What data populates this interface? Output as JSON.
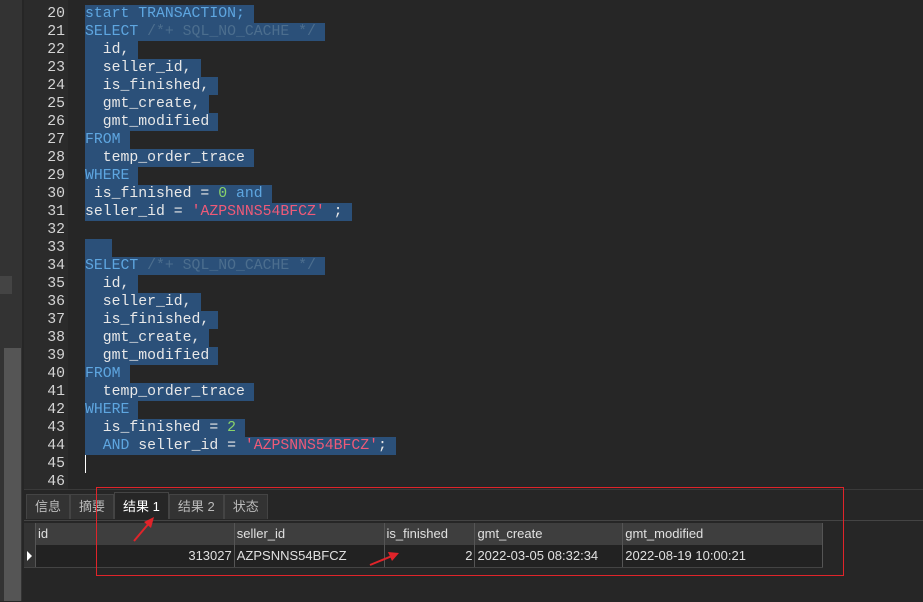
{
  "editor": {
    "lines": [
      {
        "n": "20",
        "tokens": [
          {
            "t": "start TRANSACTION;",
            "c": "kw2"
          }
        ]
      },
      {
        "n": "21",
        "tokens": [
          {
            "t": "SELECT",
            "c": "kw"
          },
          {
            "t": " /*+ SQL_NO_CACHE */",
            "c": "cm"
          }
        ]
      },
      {
        "n": "22",
        "tokens": [
          {
            "t": "  id,",
            "c": ""
          }
        ]
      },
      {
        "n": "23",
        "tokens": [
          {
            "t": "  seller_id,",
            "c": ""
          }
        ]
      },
      {
        "n": "24",
        "tokens": [
          {
            "t": "  is_finished,",
            "c": ""
          }
        ]
      },
      {
        "n": "25",
        "tokens": [
          {
            "t": "  gmt_create,",
            "c": ""
          }
        ]
      },
      {
        "n": "26",
        "tokens": [
          {
            "t": "  gmt_modified",
            "c": ""
          }
        ]
      },
      {
        "n": "27",
        "tokens": [
          {
            "t": "FROM",
            "c": "kw"
          }
        ]
      },
      {
        "n": "28",
        "tokens": [
          {
            "t": "  temp_order_trace",
            "c": ""
          }
        ]
      },
      {
        "n": "29",
        "tokens": [
          {
            "t": "WHERE",
            "c": "kw"
          }
        ]
      },
      {
        "n": "30",
        "tokens": [
          {
            "t": " is_finished = ",
            "c": ""
          },
          {
            "t": "0",
            "c": "num"
          },
          {
            "t": " ",
            "c": ""
          },
          {
            "t": "and",
            "c": "kw"
          }
        ]
      },
      {
        "n": "31",
        "tokens": [
          {
            "t": "seller_id = ",
            "c": ""
          },
          {
            "t": "'AZPSNNS54BFCZ'",
            "c": "str"
          },
          {
            "t": " ;",
            "c": ""
          }
        ]
      },
      {
        "n": "32",
        "tokens": [
          {
            "t": "",
            "c": ""
          }
        ]
      },
      {
        "n": "33",
        "tokens": [
          {
            "t": "  ",
            "c": ""
          }
        ]
      },
      {
        "n": "34",
        "tokens": [
          {
            "t": "SELECT",
            "c": "kw"
          },
          {
            "t": " /*+ SQL_NO_CACHE */",
            "c": "cm"
          }
        ]
      },
      {
        "n": "35",
        "tokens": [
          {
            "t": "  id,",
            "c": ""
          }
        ]
      },
      {
        "n": "36",
        "tokens": [
          {
            "t": "  seller_id,",
            "c": ""
          }
        ]
      },
      {
        "n": "37",
        "tokens": [
          {
            "t": "  is_finished,",
            "c": ""
          }
        ]
      },
      {
        "n": "38",
        "tokens": [
          {
            "t": "  gmt_create,",
            "c": ""
          }
        ]
      },
      {
        "n": "39",
        "tokens": [
          {
            "t": "  gmt_modified",
            "c": ""
          }
        ]
      },
      {
        "n": "40",
        "tokens": [
          {
            "t": "FROM",
            "c": "kw"
          }
        ]
      },
      {
        "n": "41",
        "tokens": [
          {
            "t": "  temp_order_trace",
            "c": ""
          }
        ]
      },
      {
        "n": "42",
        "tokens": [
          {
            "t": "WHERE",
            "c": "kw"
          }
        ]
      },
      {
        "n": "43",
        "tokens": [
          {
            "t": "  is_finished = ",
            "c": ""
          },
          {
            "t": "2",
            "c": "num"
          }
        ]
      },
      {
        "n": "44",
        "tokens": [
          {
            "t": "  ",
            "c": ""
          },
          {
            "t": "AND",
            "c": "kw"
          },
          {
            "t": " seller_id = ",
            "c": ""
          },
          {
            "t": "'AZPSNNS54BFCZ'",
            "c": "str"
          },
          {
            "t": ";",
            "c": ""
          }
        ]
      },
      {
        "n": "45",
        "tokens": [],
        "cursor": true,
        "unselected": true
      },
      {
        "n": "46",
        "tokens": [],
        "unselected": true
      }
    ]
  },
  "tabs": [
    "信息",
    "摘要",
    "结果 1",
    "结果 2",
    "状态"
  ],
  "active_tab": 2,
  "grid": {
    "columns": [
      "id",
      "seller_id",
      "is_finished",
      "gmt_create",
      "gmt_modified"
    ],
    "rows": [
      [
        "313027",
        "AZPSNNS54BFCZ",
        "2",
        "2022-03-05 08:32:34",
        "2022-08-19 10:00:21"
      ]
    ]
  },
  "colors": {
    "selection": "#2b5079",
    "keyword": "#5ea6e0",
    "annotation": "#e0242a"
  }
}
